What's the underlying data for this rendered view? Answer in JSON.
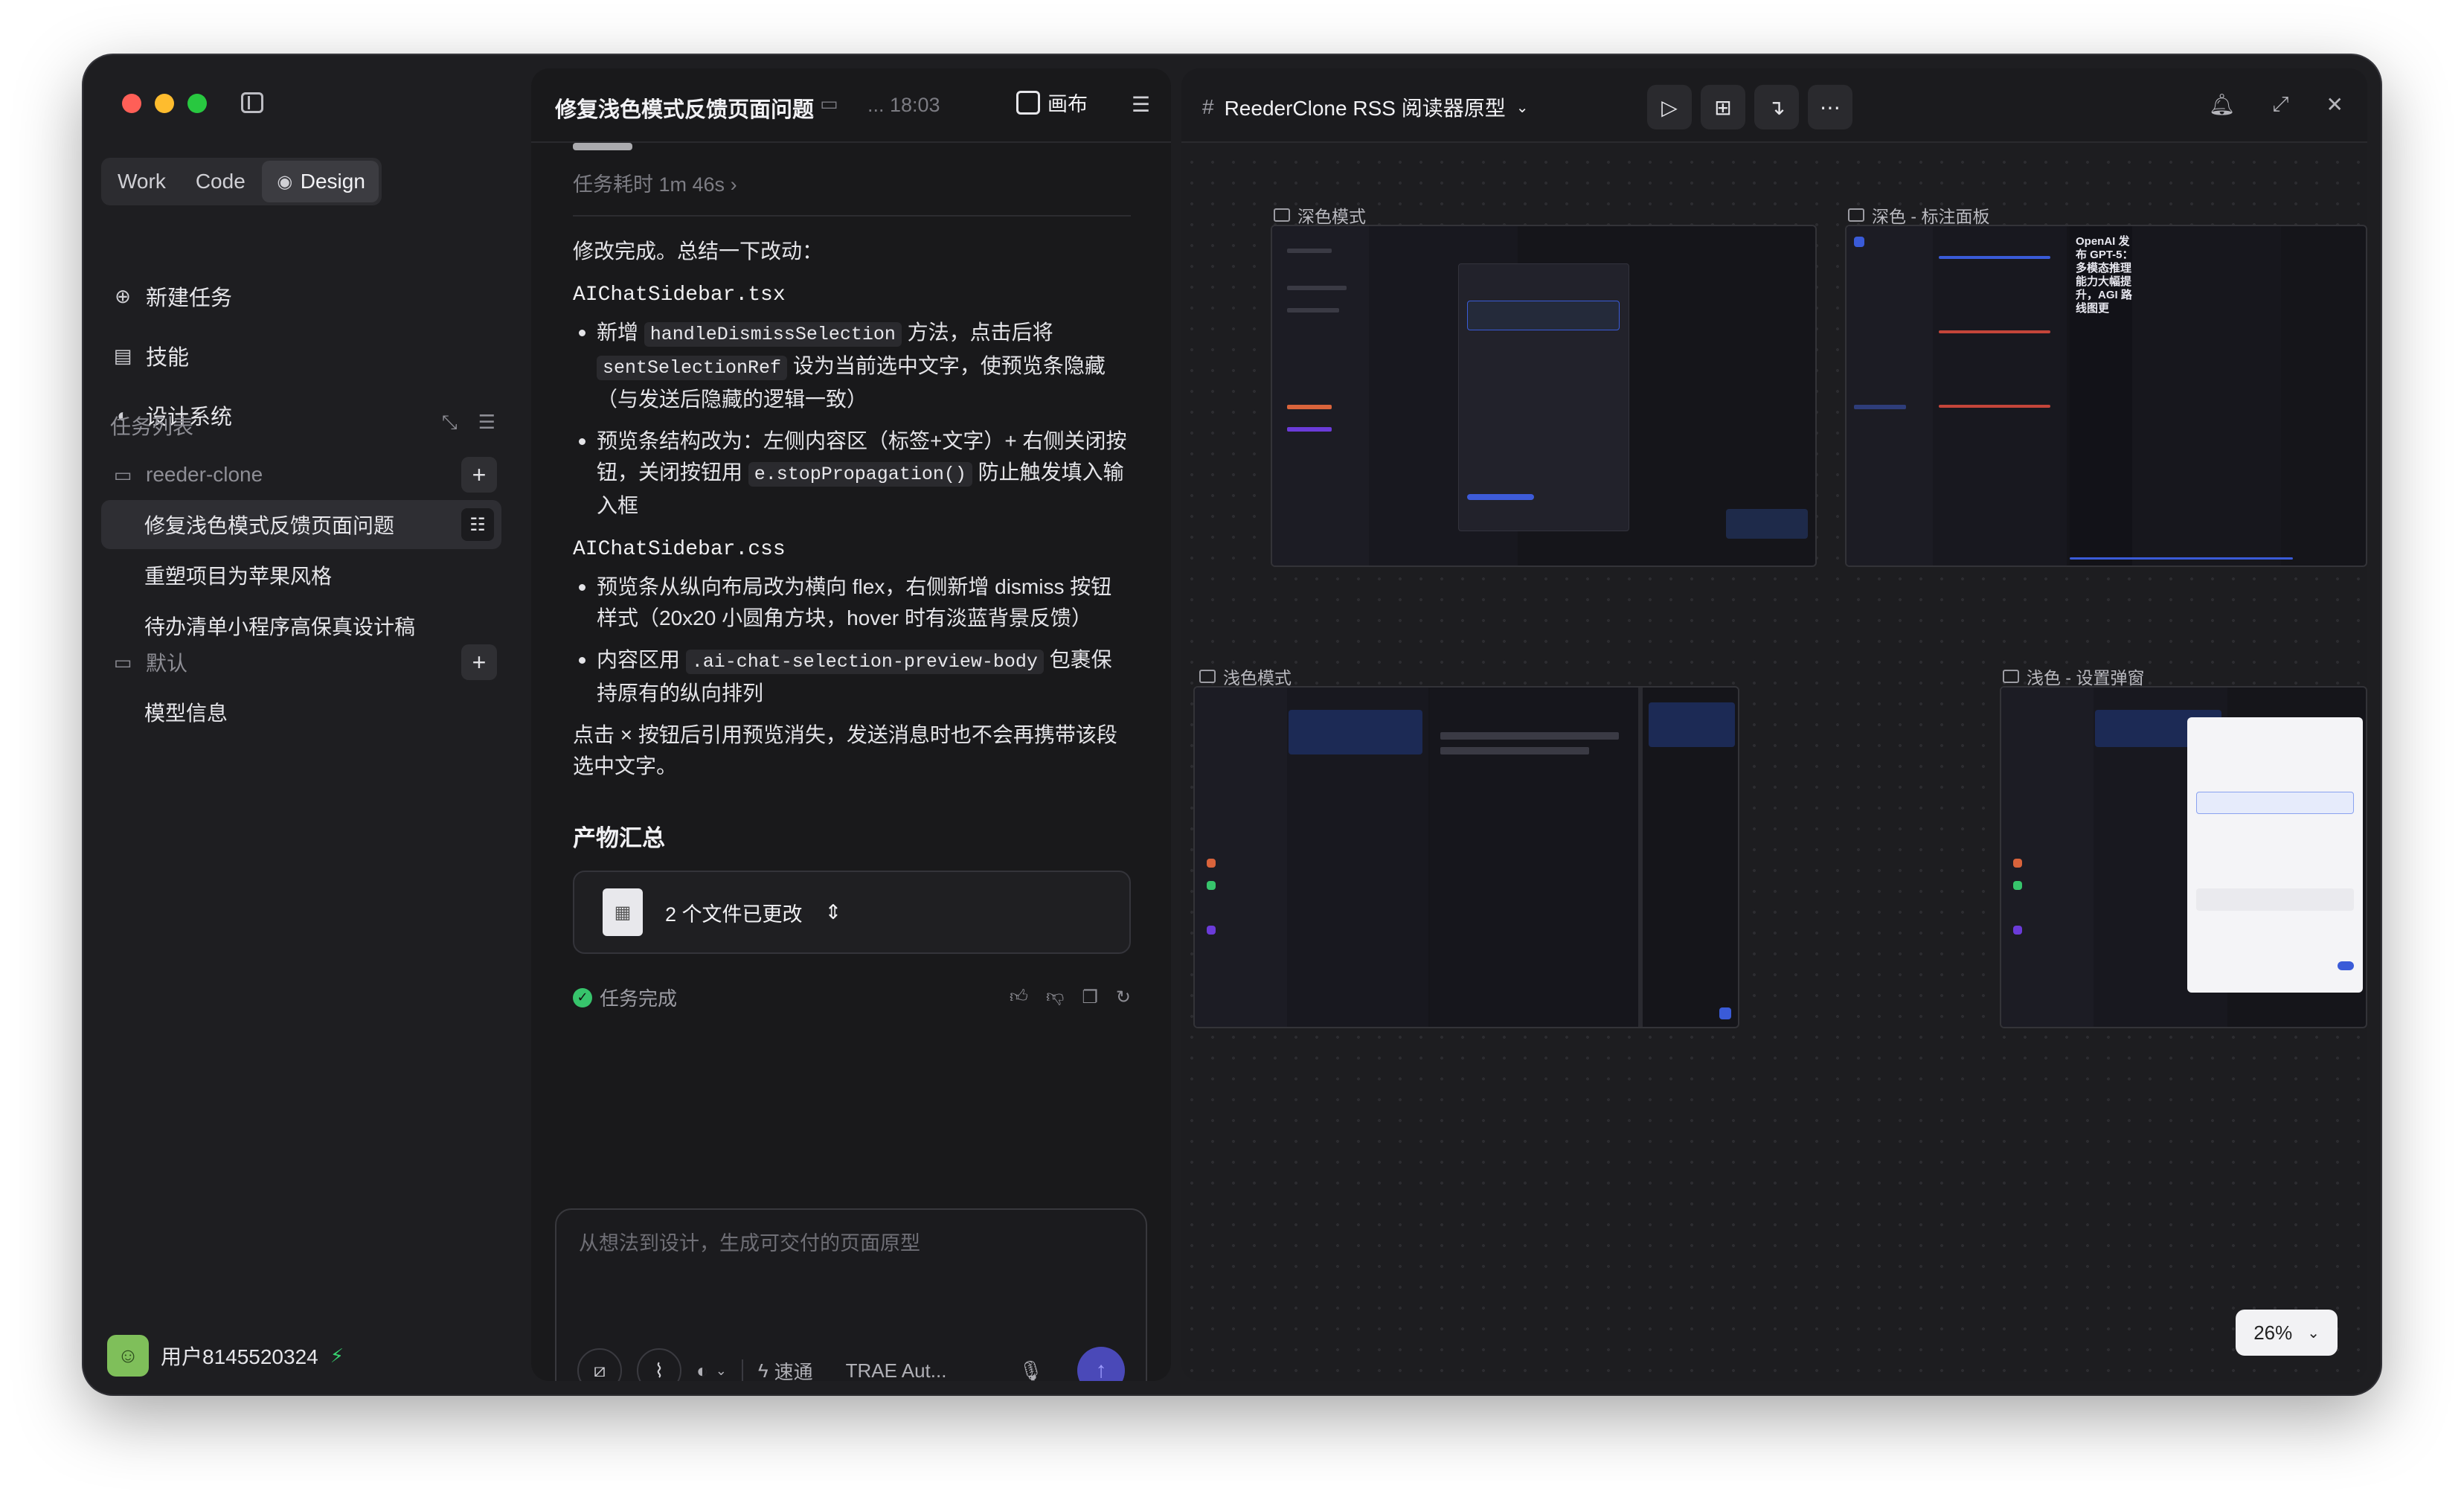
{
  "sidebar": {
    "modes": [
      {
        "label": "Work"
      },
      {
        "label": "Code"
      },
      {
        "label": "Design"
      }
    ],
    "nav": [
      {
        "label": "新建任务",
        "icon": "new-task-icon"
      },
      {
        "label": "技能",
        "icon": "book-icon"
      },
      {
        "label": "设计系统",
        "icon": "design-system-icon"
      }
    ],
    "task_section_label": "任务列表",
    "folders": [
      {
        "label": "reeder-clone",
        "tasks": [
          "修复浅色模式反馈页面问题",
          "重塑项目为苹果风格",
          "待办清单小程序高保真设计稿"
        ]
      },
      {
        "label": "默认",
        "tasks": [
          "模型信息"
        ]
      }
    ],
    "user": {
      "name": "用户8145520324"
    }
  },
  "chat": {
    "title": "修复浅色模式反馈页面问题",
    "time": "... 18:03",
    "canvas_button": "画布",
    "duration": "任务耗时 1m 46s",
    "summary": "修改完成。总结一下改动：",
    "file1": "AIChatSidebar.tsx",
    "b1_pre": "新增 ",
    "b1_code1": "handleDismissSelection",
    "b1_mid": " 方法，点击后将 ",
    "b1_code2": "sentSelectionRef",
    "b1_post": " 设为当前选中文字，使预览条隐藏（与发送后隐藏的逻辑一致）",
    "b2_pre": "预览条结构改为：左侧内容区（标签+文字）+ 右侧关闭按钮，关闭按钮用 ",
    "b2_code": "e.stopPropagation()",
    "b2_post": " 防止触发填入输入框",
    "file2": "AIChatSidebar.css",
    "b3": "预览条从纵向布局改为横向 flex，右侧新增 dismiss 按钮样式（20x20 小圆角方块，hover 时有淡蓝背景反馈）",
    "b4_pre": "内容区用 ",
    "b4_code": ".ai-chat-selection-preview-body",
    "b4_post": " 包裹保持原有的纵向排列",
    "closing": "点击 × 按钮后引用预览消失，发送消息时也不会再携带该段选中文字。",
    "artifacts_title": "产物汇总",
    "files_changed": "2 个文件已更改",
    "status": "任务完成",
    "composer_placeholder": "从想法到设计，生成可交付的页面原型",
    "speed_label": "速通",
    "model_label": "TRAE Aut..."
  },
  "canvas": {
    "project_title": "ReederClone RSS 阅读器原型",
    "artboards": [
      {
        "label": "深色模式"
      },
      {
        "label": "深色 - 标注面板"
      },
      {
        "label": "浅色模式"
      },
      {
        "label": "浅色 - 设置弹窗"
      }
    ],
    "annot_text": "OpenAI 发布 GPT-5：多模态推理能力大幅提升，AGI 路线图更",
    "zoom": "26%"
  },
  "colors": {
    "accent": "#4a49b8",
    "success": "#37c46c",
    "window_bg": "#1e1e21"
  }
}
